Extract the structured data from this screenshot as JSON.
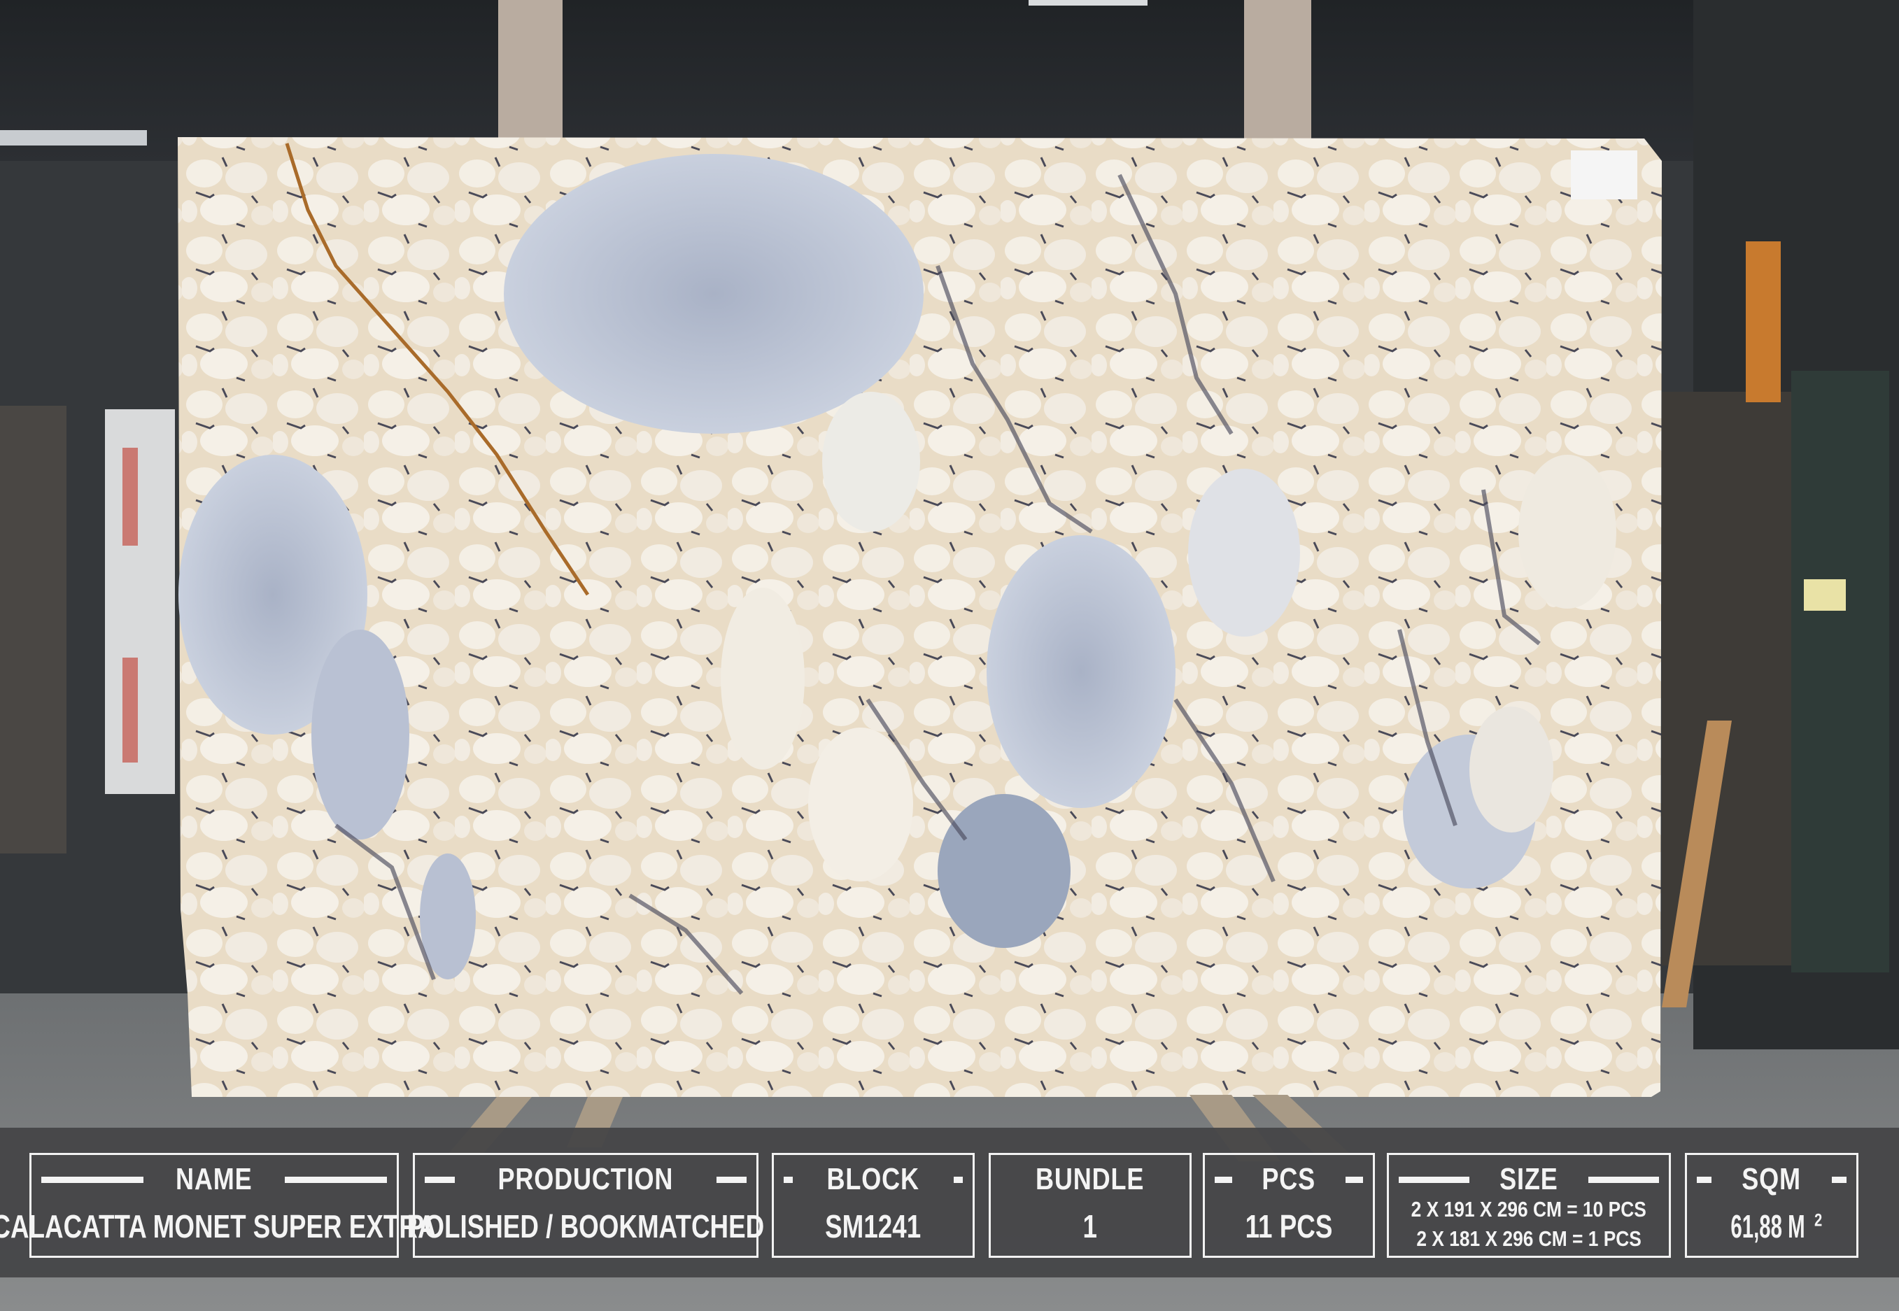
{
  "info": {
    "name": {
      "label": "NAME",
      "value": "CALACATTA MONET SUPER EXTRA"
    },
    "production": {
      "label": "PRODUCTION",
      "value": "POLISHED /  BOOKMATCHED"
    },
    "block": {
      "label": "BLOCK",
      "value": "SM1241"
    },
    "bundle": {
      "label": "BUNDLE",
      "value": "1"
    },
    "pcs": {
      "label": "PCS",
      "value": "11 PCS"
    },
    "size": {
      "label": "SIZE",
      "line1": "2 X 191 X  296 CM = 10 PCS",
      "line2": "2 X 181 X  296 CM = 1 PCS"
    },
    "sqm": {
      "label": "SQM",
      "value": "61,88 M",
      "exponent": "2"
    }
  }
}
